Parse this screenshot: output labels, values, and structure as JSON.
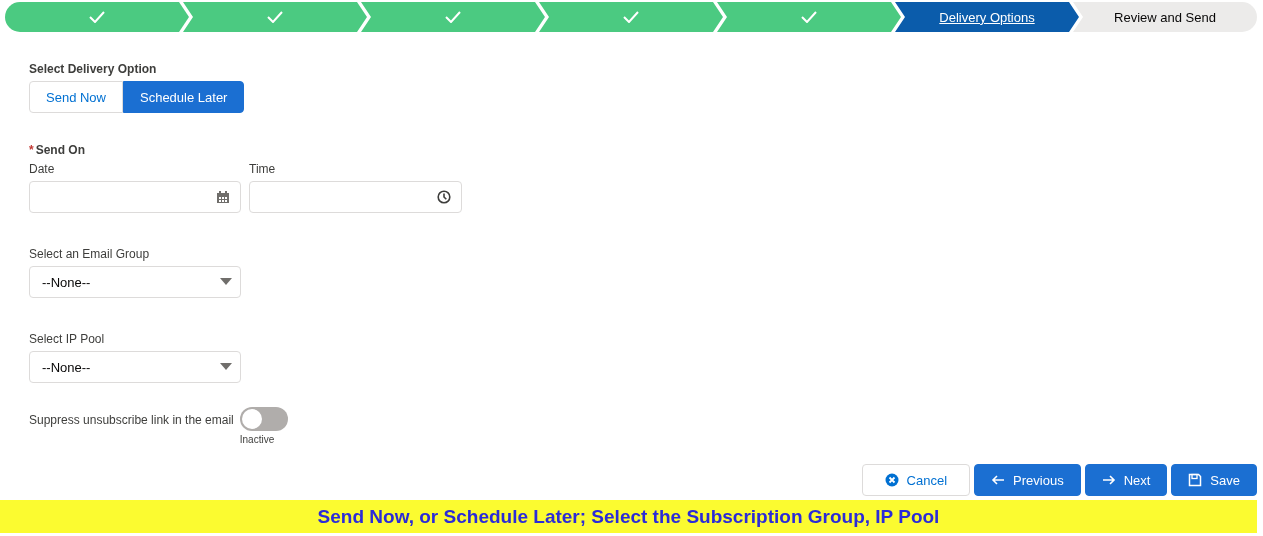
{
  "path": [
    {
      "kind": "complete"
    },
    {
      "kind": "complete"
    },
    {
      "kind": "complete"
    },
    {
      "kind": "complete"
    },
    {
      "kind": "complete"
    },
    {
      "kind": "current",
      "label": "Delivery Options"
    },
    {
      "kind": "incomplete",
      "label": "Review and Send"
    }
  ],
  "delivery_option": {
    "label": "Select Delivery Option",
    "options": [
      {
        "label": "Send Now",
        "selected": false
      },
      {
        "label": "Schedule Later",
        "selected": true
      }
    ]
  },
  "send_on": {
    "label": "Send On",
    "required_mark": "*",
    "date": {
      "label": "Date"
    },
    "time": {
      "label": "Time"
    }
  },
  "email_group": {
    "label": "Select an Email Group",
    "value": "--None--"
  },
  "ip_pool": {
    "label": "Select IP Pool",
    "value": "--None--"
  },
  "suppress": {
    "label": "Suppress unsubscribe link in the email",
    "checked": false,
    "status": "Inactive"
  },
  "buttons": [
    {
      "label": "Cancel",
      "kind": "cancel"
    },
    {
      "label": "Previous",
      "kind": "previous"
    },
    {
      "label": "Next",
      "kind": "next"
    },
    {
      "label": "Save",
      "kind": "save"
    }
  ],
  "banner": "Send Now, or Schedule Later; Select the Subscription Group, IP Pool"
}
